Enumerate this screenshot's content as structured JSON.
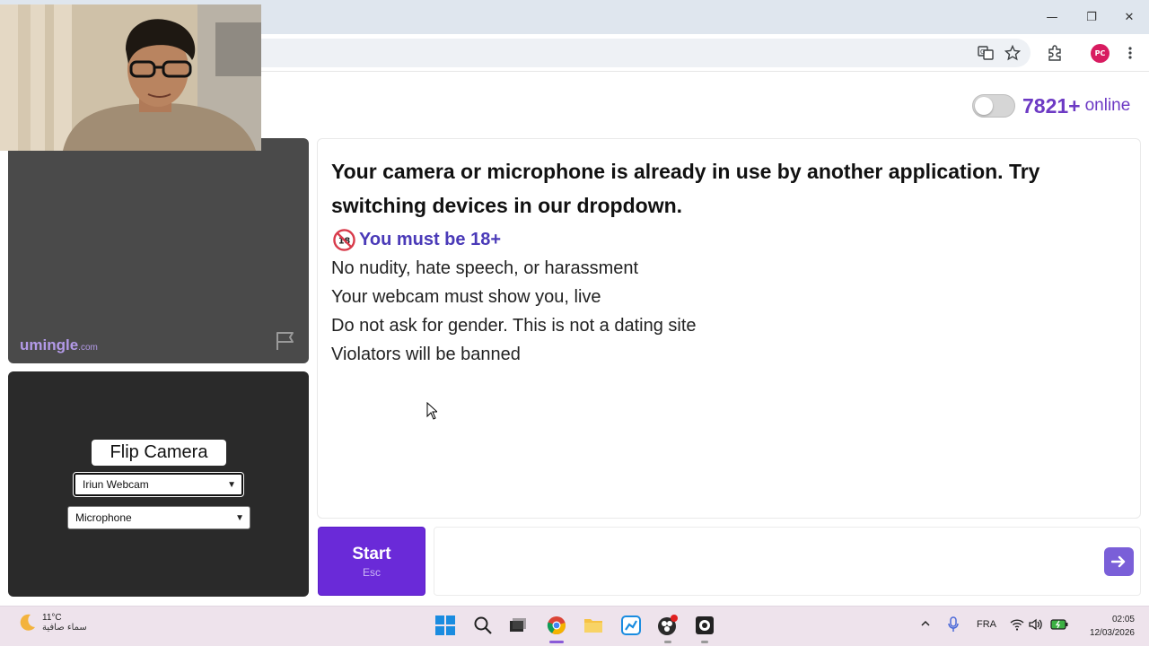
{
  "browser": {
    "window_controls": {
      "minimize": "—",
      "restore": "❐",
      "close": "✕"
    },
    "profile_initials": "PC"
  },
  "site": {
    "online_count": "7821+",
    "online_label": "online",
    "brand": "umingle",
    "brand_suffix": ".com"
  },
  "local_controls": {
    "flip_camera_label": "Flip Camera",
    "camera_select_value": "Iriun Webcam",
    "microphone_select_value": "Microphone"
  },
  "chat": {
    "error_message": "Your camera or microphone is already in use by another application. Try switching devices in our dropdown.",
    "age_notice": "You must be 18+",
    "rules": [
      "No nudity, hate speech, or harassment",
      "Your webcam must show you, live",
      "Do not ask for gender. This is not a dating site",
      "Violators will be banned"
    ]
  },
  "actions": {
    "start_label": "Start",
    "start_shortcut": "Esc"
  },
  "taskbar": {
    "temperature": "11°C",
    "weather_desc": "سماء صافية",
    "language": "FRA",
    "time": "02:05",
    "date": "12/03/2026"
  },
  "colors": {
    "accent": "#6a2ad8",
    "online_text": "#6d3ac4",
    "age_text": "#4a3ab8"
  }
}
